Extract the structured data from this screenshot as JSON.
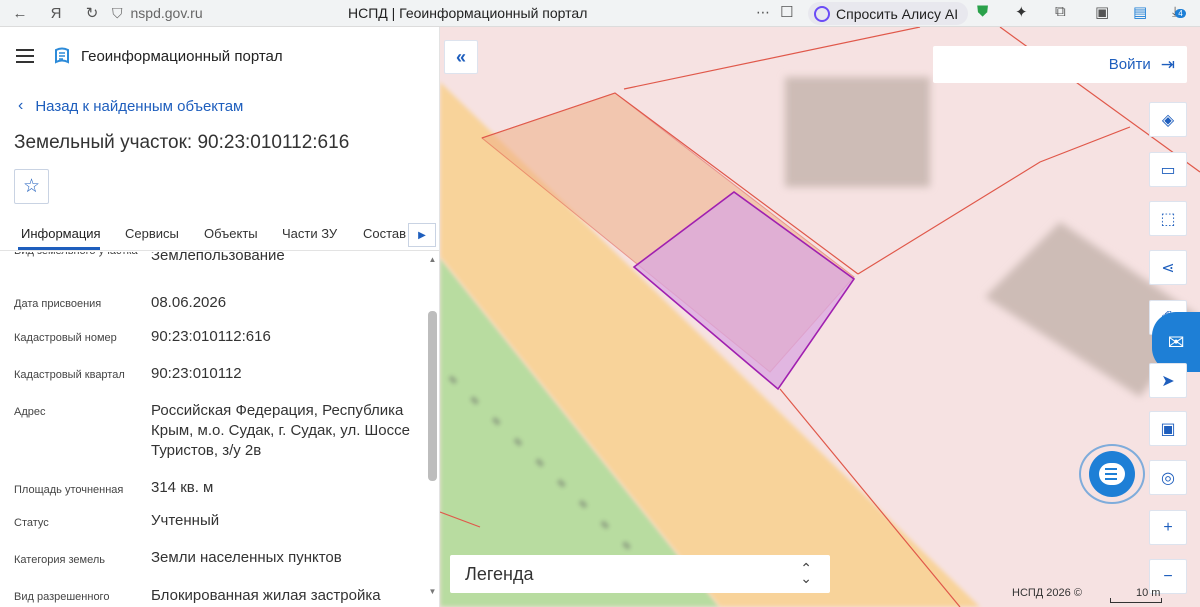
{
  "browser": {
    "url": "nspd.gov.ru",
    "tab_title": "НСПД | Геоинформационный портал",
    "alice_label": "Спросить Алису AI",
    "downloads_badge": "4"
  },
  "app": {
    "title": "Геоинформационный портал",
    "back_label": "Назад к найденным объектам",
    "parcel_title": "Земельный участок: 90:23:010112:616"
  },
  "tabs": [
    {
      "label": "Информация",
      "active": true
    },
    {
      "label": "Сервисы"
    },
    {
      "label": "Объекты"
    },
    {
      "label": "Части ЗУ"
    },
    {
      "label": "Состав"
    }
  ],
  "info": {
    "rows": [
      {
        "key": "Вид земельного участка",
        "value": "Землепользование"
      },
      {
        "key": "Дата присвоения",
        "value": "08.06.2026"
      },
      {
        "key": "Кадастровый номер",
        "value": "90:23:010112:616"
      },
      {
        "key": "Кадастровый квартал",
        "value": "90:23:010112"
      },
      {
        "key": "Адрес",
        "value": "Российская Федерация, Республика Крым, м.о. Судак, г. Судак, ул. Шоссе Туристов, з/у 2в"
      },
      {
        "key": "Площадь уточненная",
        "value": "314 кв. м"
      },
      {
        "key": "Статус",
        "value": "Учтенный"
      },
      {
        "key": "Категория земель",
        "value": "Земли населенных пунктов"
      },
      {
        "key": "Вид разрешенного",
        "value": "Блокированная жилая застройка"
      }
    ]
  },
  "map": {
    "login_label": "Войти",
    "legend_label": "Легенда",
    "copyright": "НСПД 2026 ©",
    "scale_label": "10 m",
    "colors": {
      "background": "#f6e2e2",
      "road": "#f8d39a",
      "green": "#b8dca0",
      "parcel_fill": "#d9a7e0",
      "parcel_stroke": "#a020b0",
      "boundary": "#e0584a",
      "accent": "#1e5ebd"
    },
    "tools": [
      "layers-icon",
      "ruler-icon",
      "select-area-icon",
      "share-icon",
      "print-icon",
      "locate-icon",
      "minimap-icon",
      "search-point-icon",
      "zoom-in-icon",
      "zoom-out-icon"
    ]
  }
}
